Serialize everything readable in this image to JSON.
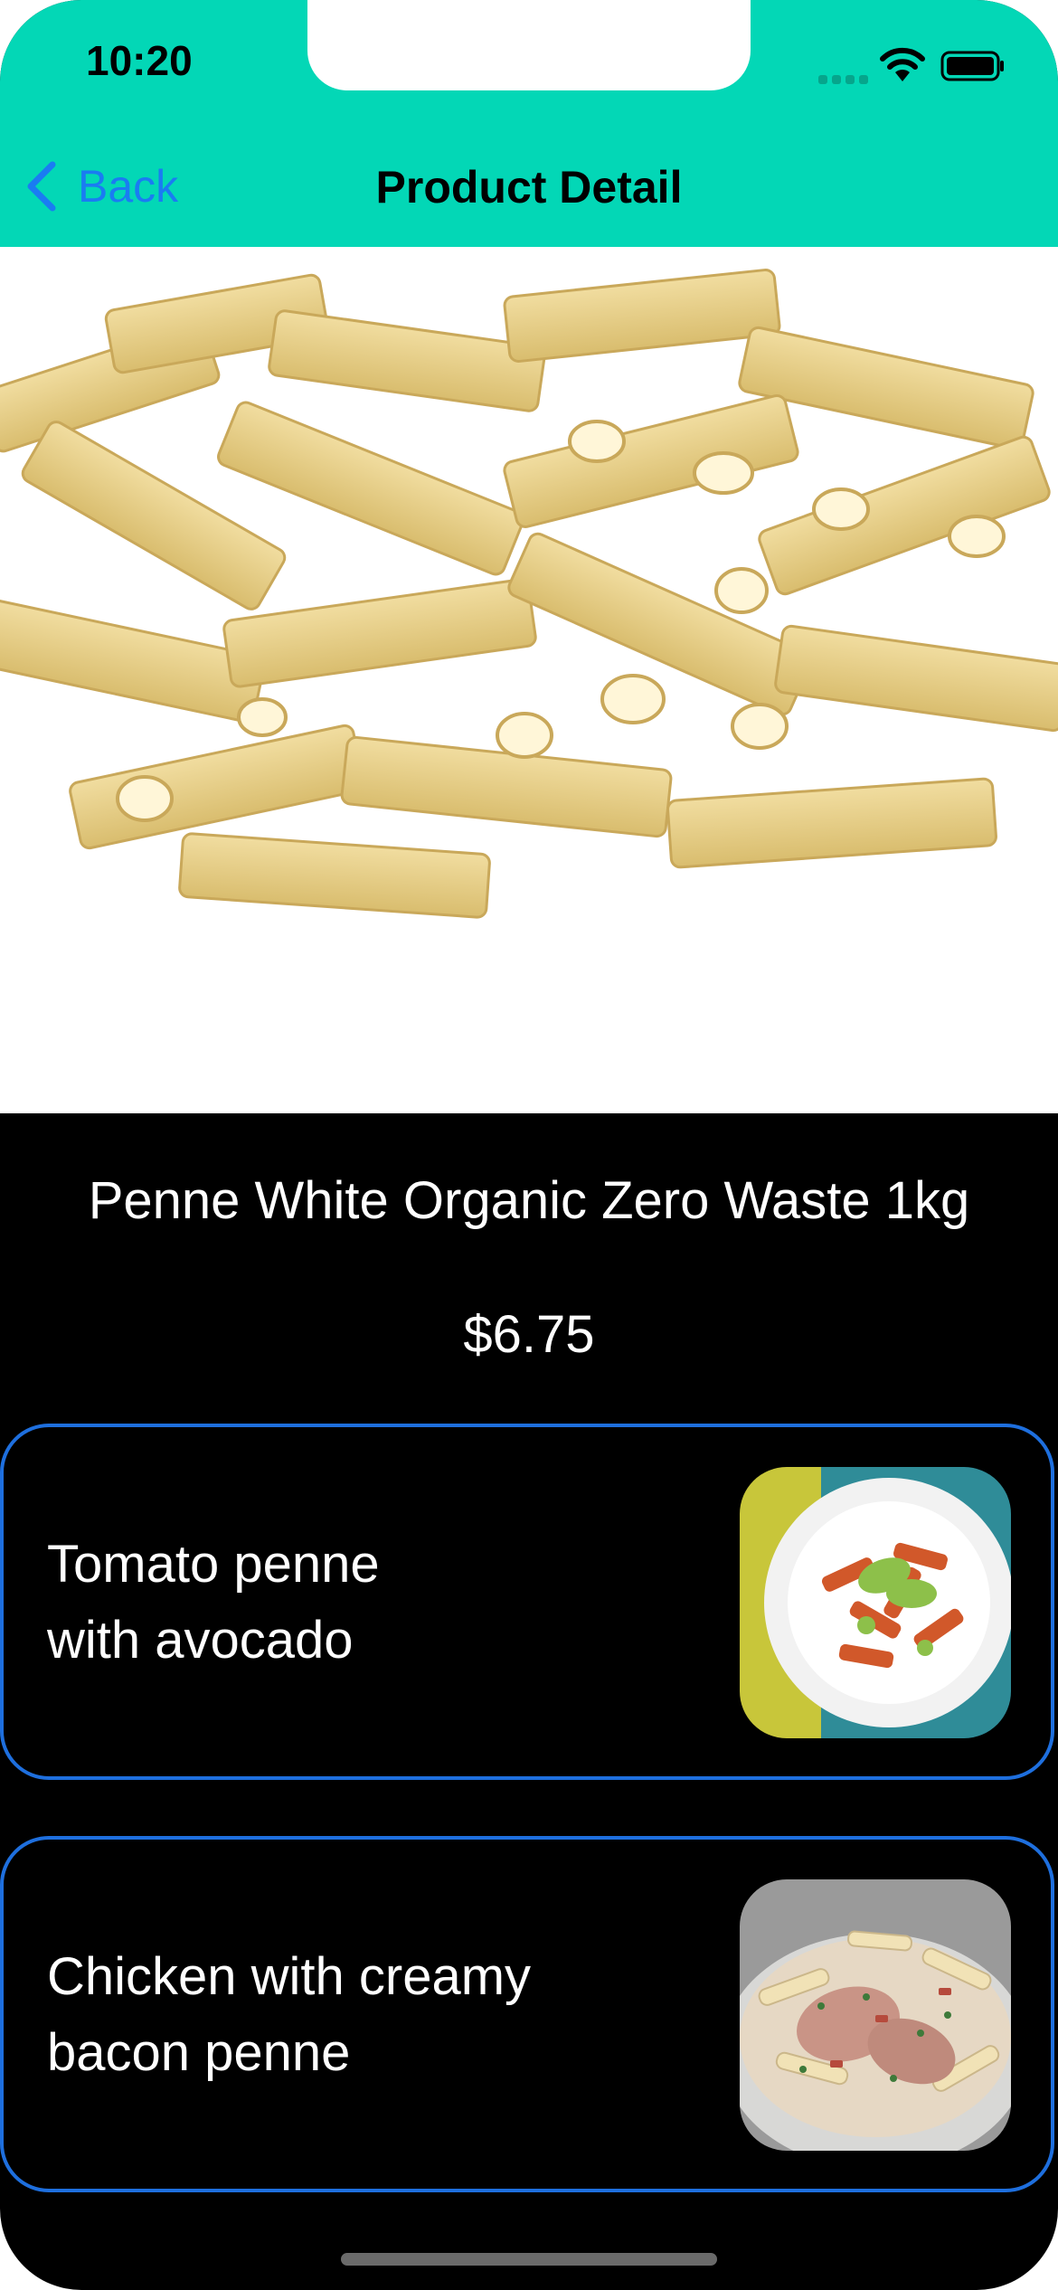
{
  "status_bar": {
    "time": "10:20"
  },
  "nav": {
    "back_label": "Back",
    "title": "Product Detail"
  },
  "product": {
    "name": "Penne White Organic Zero Waste 1kg",
    "price": "$6.75",
    "image_icon": "penne-pasta-image"
  },
  "recipes": [
    {
      "label_line1": "Tomato penne",
      "label_line2": "with avocado",
      "image_icon": "tomato-penne-avocado-photo"
    },
    {
      "label_line1": "Chicken with creamy",
      "label_line2": "bacon penne",
      "image_icon": "chicken-bacon-penne-photo"
    }
  ],
  "colors": {
    "header_bg": "#03D7B6",
    "accent": "#1A7CF2",
    "card_border": "#1E6FDE",
    "background": "#000000"
  }
}
